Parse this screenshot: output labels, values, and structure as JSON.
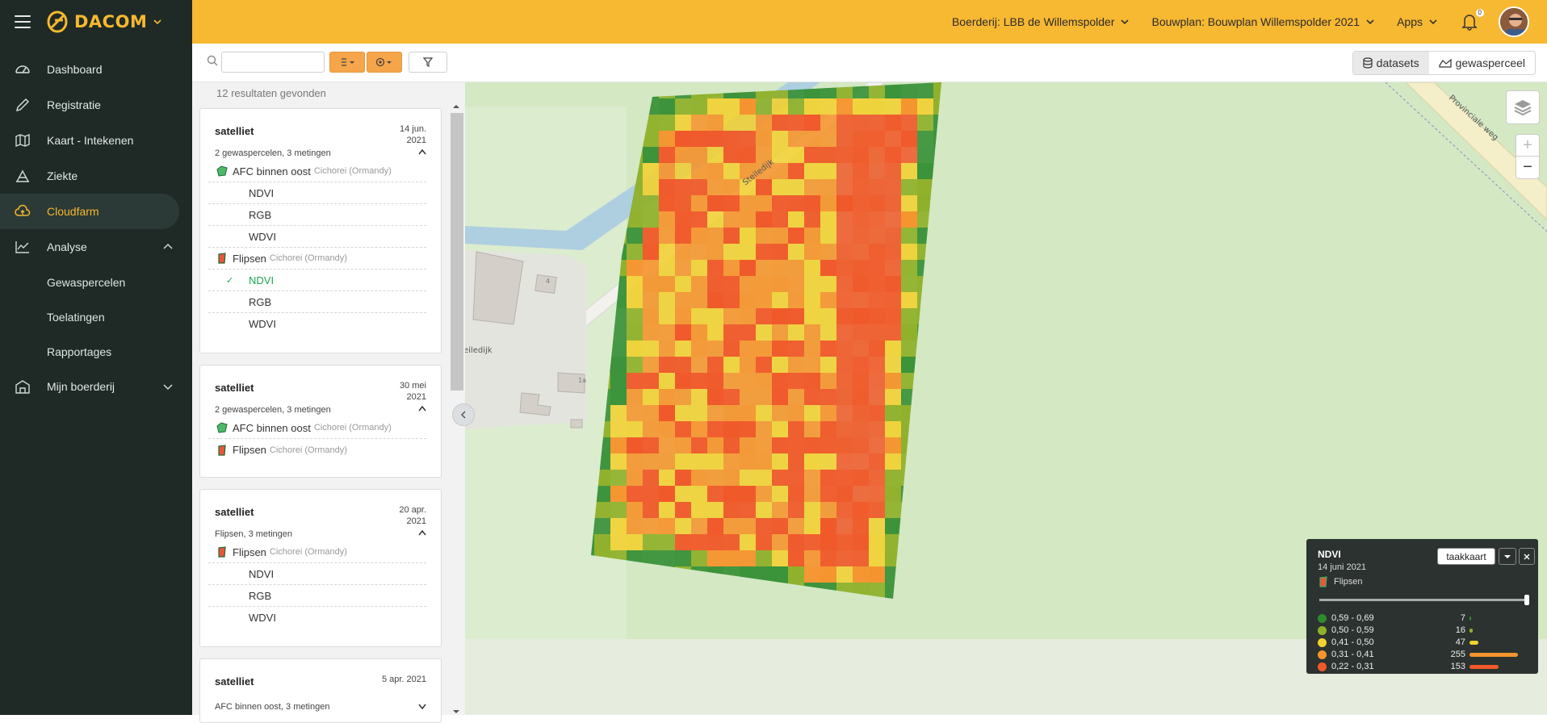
{
  "brand": {
    "name": "DACOM"
  },
  "sidebar": {
    "items": [
      {
        "label": "Dashboard",
        "icon": "gauge-icon"
      },
      {
        "label": "Registratie",
        "icon": "pencil-icon"
      },
      {
        "label": "Kaart - Intekenen",
        "icon": "map-icon"
      },
      {
        "label": "Ziekte",
        "icon": "bug-icon"
      },
      {
        "label": "Cloudfarm",
        "icon": "cloud-upload-icon",
        "active": true
      },
      {
        "label": "Analyse",
        "icon": "chart-icon",
        "expanded": true
      },
      {
        "label": "Mijn boerderij",
        "icon": "farm-icon",
        "expanded": false
      }
    ],
    "analyse_sub": [
      "Gewaspercelen",
      "Toelatingen",
      "Rapportages"
    ]
  },
  "topbar": {
    "farm": "Boerderij: LBB de Willemspolder",
    "plan": "Bouwplan: Bouwplan Willemspolder 2021",
    "apps": "Apps",
    "notifications": "0"
  },
  "toolbar": {
    "search_value": "",
    "seg_datasets": "datasets",
    "seg_field": "gewasperceel"
  },
  "panel": {
    "results": "12 resultaten gevonden",
    "cards": [
      {
        "type": "satelliet",
        "date": "14 jun. 2021",
        "summary": "2 gewaspercelen, 3 metingen",
        "fields": [
          {
            "name": "AFC binnen oost",
            "crop": "Cichorei (Ormandy)",
            "datasets": [
              "NDVI",
              "RGB",
              "WDVI"
            ]
          },
          {
            "name": "Flipsen",
            "crop": "Cichorei (Ormandy)",
            "datasets": [
              "NDVI",
              "RGB",
              "WDVI"
            ],
            "selected": "NDVI"
          }
        ]
      },
      {
        "type": "satelliet",
        "date": "30 mei 2021",
        "summary": "2 gewaspercelen, 3 metingen",
        "fields": [
          {
            "name": "AFC binnen oost",
            "crop": "Cichorei (Ormandy)"
          },
          {
            "name": "Flipsen",
            "crop": "Cichorei (Ormandy)"
          }
        ]
      },
      {
        "type": "satelliet",
        "date": "20 apr. 2021",
        "summary": "Flipsen, 3 metingen",
        "fields": [
          {
            "name": "Flipsen",
            "crop": "Cichorei (Ormandy)",
            "datasets": [
              "NDVI",
              "RGB",
              "WDVI"
            ]
          }
        ]
      },
      {
        "type": "satelliet",
        "date": "5 apr. 2021",
        "summary": "AFC binnen oost, 3 metingen"
      }
    ]
  },
  "map": {
    "labels": {
      "road1": "Steiledijk",
      "road2": "eiledijk",
      "road3": "Provinciale weg",
      "house1": "4",
      "house2": "1a"
    }
  },
  "legend": {
    "title": "NDVI",
    "date": "14 juni 2021",
    "field": "Flipsen",
    "button": "taakkaart",
    "classes": [
      {
        "range": "0,59 - 0,69",
        "count": 7,
        "color": "#2e8b2e",
        "fraction": 0.027
      },
      {
        "range": "0,50 - 0,59",
        "count": 16,
        "color": "#8fb02a",
        "fraction": 0.063
      },
      {
        "range": "0,41 - 0,50",
        "count": 47,
        "color": "#f2d02e",
        "fraction": 0.184
      },
      {
        "range": "0,31 - 0,41",
        "count": 255,
        "color": "#f5942e",
        "fraction": 1.0
      },
      {
        "range": "0,22 - 0,31",
        "count": 153,
        "color": "#f0592a",
        "fraction": 0.6
      }
    ]
  }
}
